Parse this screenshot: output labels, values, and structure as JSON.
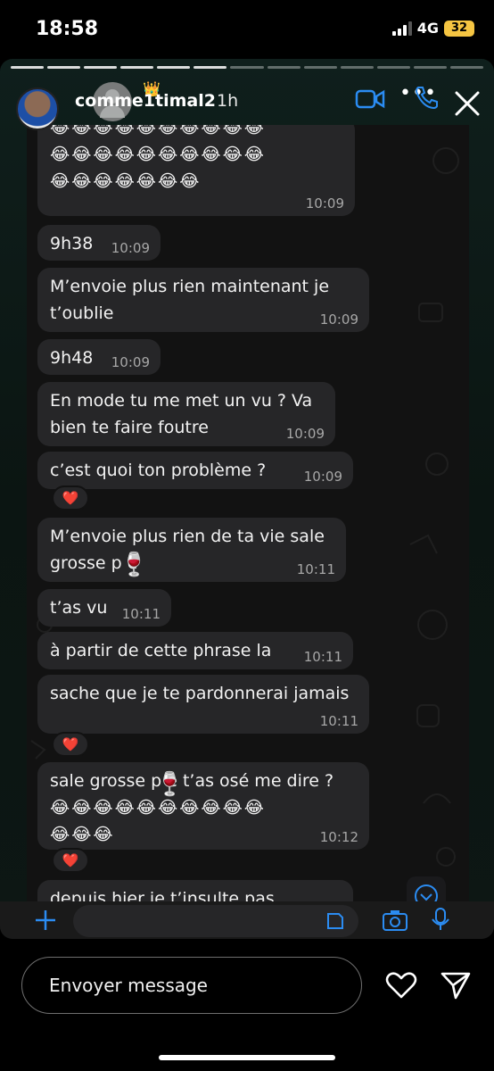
{
  "status_bar": {
    "time": "18:58",
    "network": "4G",
    "battery": "32"
  },
  "story": {
    "username": "comme1timal2",
    "time_ago": "1h",
    "crown_emoji": "👑"
  },
  "chat": {
    "messages": [
      {
        "text": "😂😂😂😂😂😂😂😂😂😂",
        "time": "10:09"
      },
      {
        "text": "9h38",
        "time": "10:09"
      },
      {
        "line1": "M’envoie plus rien maintenant je",
        "line2": "t’oublie",
        "time": "10:09"
      },
      {
        "text": "9h48",
        "time": "10:09"
      },
      {
        "line1": "En mode tu me met un vu ? Va",
        "line2": "bien te faire foutre",
        "time": "10:09"
      },
      {
        "text": "c’est quoi ton problème ?",
        "time": "10:09",
        "reaction": "❤️"
      },
      {
        "line1": "M’envoie plus rien de ta vie sale",
        "line2": "grosse p  e",
        "time": "10:11"
      },
      {
        "text": "t’as vu",
        "time": "10:11"
      },
      {
        "text": "à partir de cette phrase la",
        "time": "10:11"
      },
      {
        "text": "sache que je te pardonnerai jamais",
        "time": "10:11",
        "reaction": "❤️"
      },
      {
        "line1": "sale grosse p  e t’as osé me dire ?",
        "line2": "😂😂😂😂😂😂😂😂😂😂",
        "line3": "😂😂😂",
        "time": "10:12",
        "reaction": "❤️"
      },
      {
        "text": "depuis hier je t’insulte pas"
      }
    ],
    "emoji_row_1": "😂😂😂😂😂😂😂😂😂😂",
    "emoji_row_2": "😂😂😂😂😂😂😂😂😂😂",
    "emoji_row_3": "😂😂😂😂😂😂😂",
    "sticker_emoji": "🍷"
  },
  "reply": {
    "placeholder": "Envoyer message"
  },
  "icons": {
    "video": "video-call-icon",
    "phone": "phone-icon",
    "close": "close-icon",
    "heart": "heart-icon",
    "send": "send-icon"
  },
  "colors": {
    "bubble": "#262628",
    "chat_background": "#121212",
    "accent_blue": "#2b8cf2"
  }
}
